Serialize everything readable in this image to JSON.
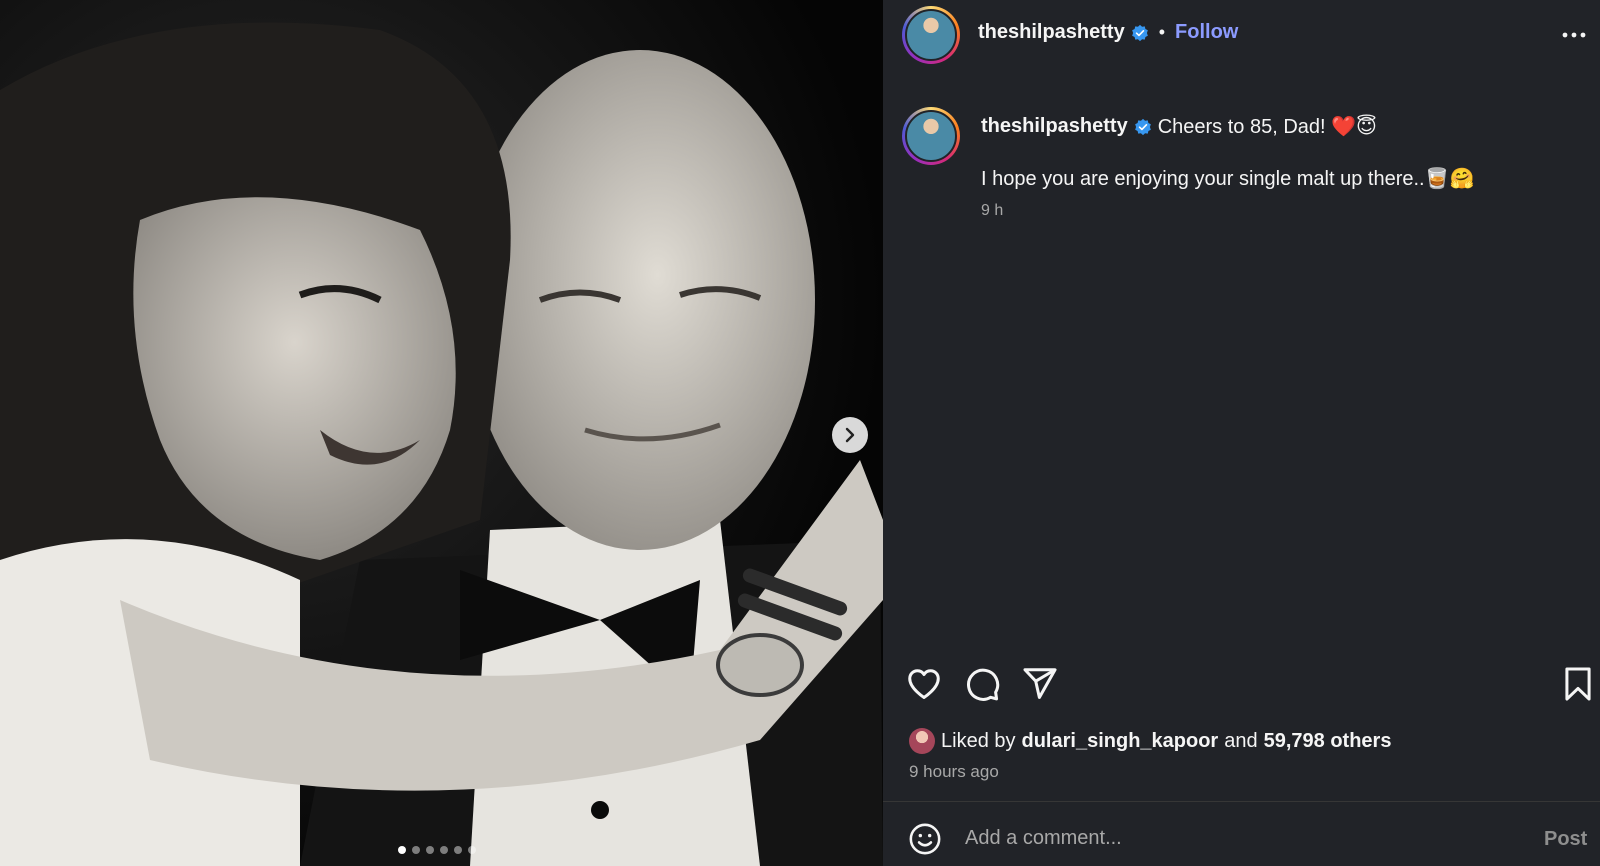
{
  "media": {
    "carousel_count": 6,
    "carousel_active_index": 0
  },
  "header": {
    "username": "theshilpashetty",
    "separator": "•",
    "follow_label": "Follow"
  },
  "caption": {
    "username": "theshilpashetty",
    "line1": "Cheers to 85, Dad! ❤️😇",
    "line2": "I hope you are enjoying your single malt up there..🥃🤗",
    "time": "9 h"
  },
  "likes": {
    "prefix": "Liked by",
    "liker": "dulari_singh_kapoor",
    "conjunction": "and",
    "others": "59,798 others"
  },
  "posted_ago": "9 hours ago",
  "comment": {
    "placeholder": "Add a comment...",
    "post_label": "Post"
  },
  "colors": {
    "panel_bg": "#212328",
    "follow": "#8c9bff",
    "muted": "#a8a8a8",
    "verified": "#3797f0"
  },
  "icons": [
    "verified-badge-icon",
    "more-options-icon",
    "chevron-right-icon",
    "heart-icon",
    "comment-icon",
    "share-icon",
    "bookmark-icon",
    "emoji-icon"
  ]
}
